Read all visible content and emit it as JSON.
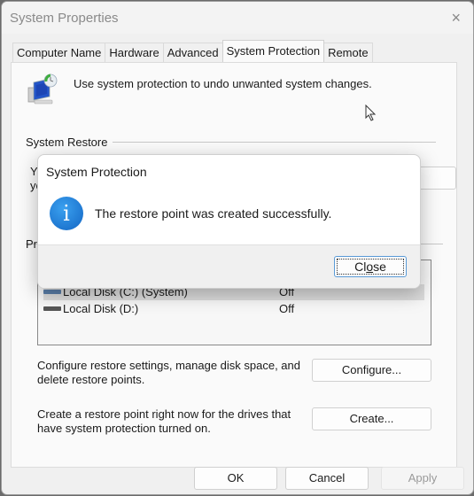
{
  "window": {
    "title": "System Properties",
    "close_icon": "×"
  },
  "tabs": [
    {
      "label": "Computer Name",
      "active": false
    },
    {
      "label": "Hardware",
      "active": false
    },
    {
      "label": "Advanced",
      "active": false
    },
    {
      "label": "System Protection",
      "active": true
    },
    {
      "label": "Remote",
      "active": false
    }
  ],
  "panel": {
    "intro": "Use system protection to undo unwanted system changes.",
    "system_restore_label": "System Restore",
    "system_restore_partial_line1": "Yo",
    "system_restore_partial_line2": "yo",
    "protection_settings_partial": "Pro",
    "drives": [
      {
        "name": "Local Disk (C:) (System)",
        "protection": "Off"
      },
      {
        "name": "Local Disk (D:)",
        "protection": "Off"
      }
    ],
    "configure_desc": "Configure restore settings, manage disk space, and delete restore points.",
    "configure_button": "Configure...",
    "create_desc": "Create a restore point right now for the drives that have system protection turned on.",
    "create_button": "Create..."
  },
  "footer": {
    "ok": "OK",
    "cancel": "Cancel",
    "apply": "Apply"
  },
  "modal": {
    "title": "System Protection",
    "icon": "info-icon",
    "icon_glyph": "i",
    "message": "The restore point was created successfully.",
    "close_button_pre": "Cl",
    "close_button_accel": "o",
    "close_button_post": "se"
  }
}
